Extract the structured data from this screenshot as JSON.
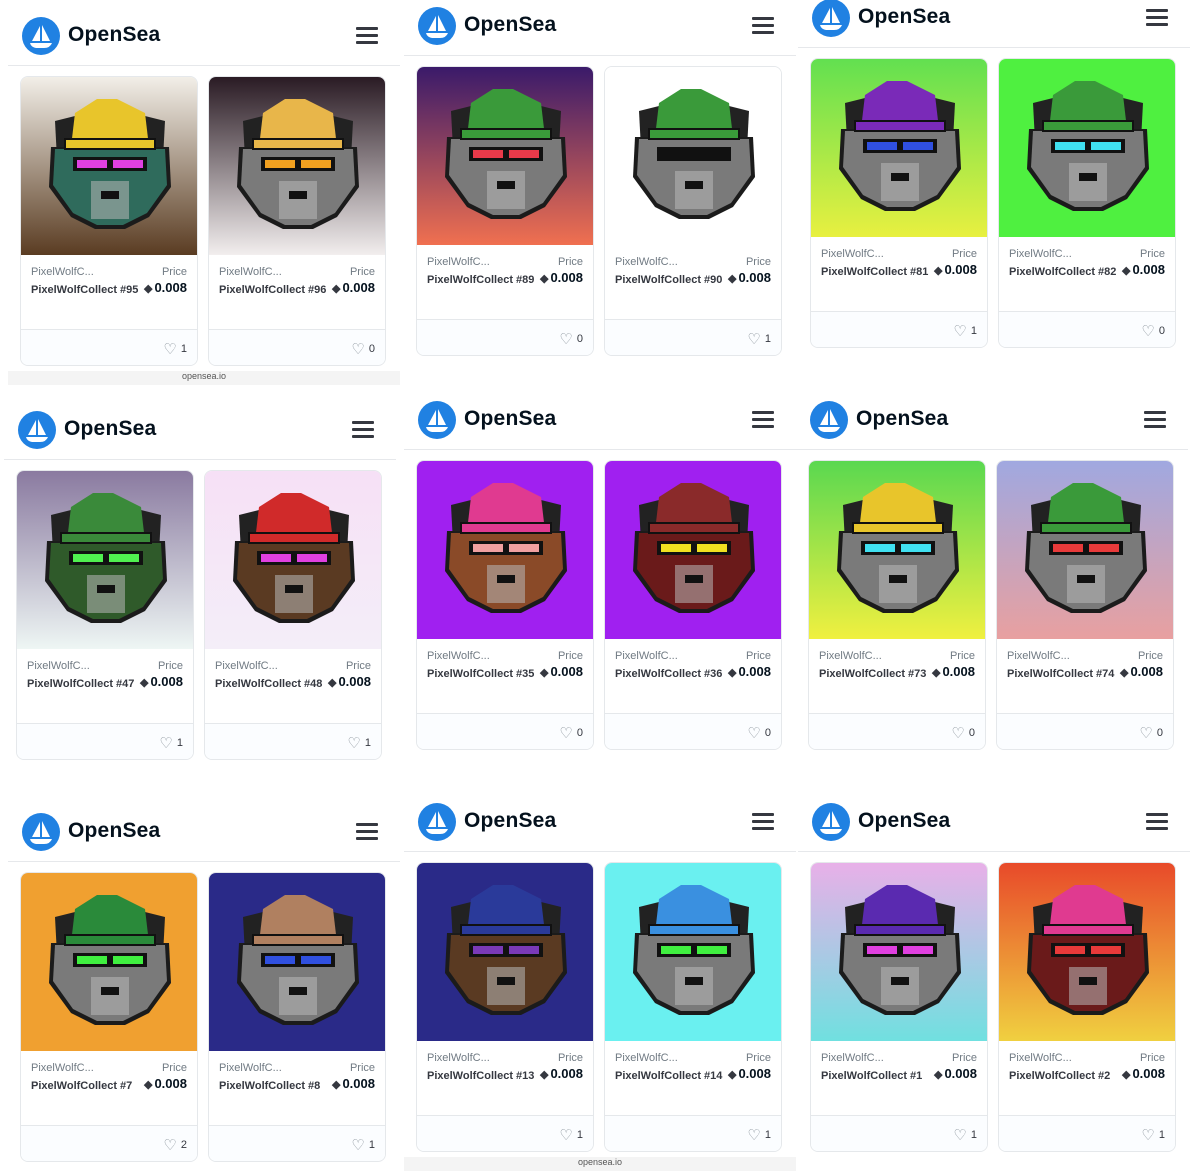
{
  "brand": "OpenSea",
  "url_text": "opensea.io",
  "price_label": "Price",
  "collection_short": "PixelWolfC...",
  "panels": [
    {
      "cards": [
        {
          "name": "PixelWolfCollect #95",
          "price": "0.008",
          "likes": "1",
          "bg": [
            "#f2efe8",
            "#5a3c22"
          ],
          "fur": "#2f6b5c",
          "hat": "#e8c52b",
          "glasses": "#e040e0"
        },
        {
          "name": "PixelWolfCollect #96",
          "price": "0.008",
          "likes": "0",
          "bg": [
            "#2a1b24",
            "#f2eeee"
          ],
          "fur": "#7a7a7a",
          "hat": "#e8b64a",
          "glasses": "#f0a020"
        }
      ]
    },
    {
      "cards": [
        {
          "name": "PixelWolfCollect #89",
          "price": "0.008",
          "likes": "0",
          "bg": [
            "#3a1a6a",
            "#f07050"
          ],
          "fur": "#7a7a7a",
          "hat": "#3a9a3a",
          "glasses": "#e83a4a"
        },
        {
          "name": "PixelWolfCollect #90",
          "price": "0.008",
          "likes": "1",
          "bg": [
            "#ffffff",
            "#ffffff"
          ],
          "fur": "#7a7a7a",
          "hat": "#3a9a3a",
          "glasses": "#111111"
        }
      ]
    },
    {
      "cards": [
        {
          "name": "PixelWolfCollect #81",
          "price": "0.008",
          "likes": "1",
          "bg": [
            "#62e050",
            "#e8f040"
          ],
          "fur": "#7a7a7a",
          "hat": "#7a2ab8",
          "glasses": "#3050e0"
        },
        {
          "name": "PixelWolfCollect #82",
          "price": "0.008",
          "likes": "0",
          "bg": [
            "#4ff040",
            "#4ff040"
          ],
          "fur": "#7a7a7a",
          "hat": "#3a9a3a",
          "glasses": "#40e0f0"
        }
      ]
    },
    {
      "cards": [
        {
          "name": "PixelWolfCollect #47",
          "price": "0.008",
          "likes": "1",
          "bg": [
            "#8a7aa0",
            "#eef6f4"
          ],
          "fur": "#2f5a2a",
          "hat": "#3a8a3a",
          "glasses": "#50f050"
        },
        {
          "name": "PixelWolfCollect #48",
          "price": "0.008",
          "likes": "1",
          "bg": [
            "#f6e0f6",
            "#f4eef8"
          ],
          "fur": "#5a3a22",
          "hat": "#d02a2a",
          "glasses": "#e040e0"
        }
      ]
    },
    {
      "cards": [
        {
          "name": "PixelWolfCollect #35",
          "price": "0.008",
          "likes": "0",
          "bg": [
            "#a020f0",
            "#a020f0"
          ],
          "fur": "#8a4a28",
          "hat": "#e03a90",
          "glasses": "#f0a0a0"
        },
        {
          "name": "PixelWolfCollect #36",
          "price": "0.008",
          "likes": "0",
          "bg": [
            "#a020f0",
            "#a020f0"
          ],
          "fur": "#6a1a1a",
          "hat": "#8a2a2a",
          "glasses": "#f0e020"
        }
      ]
    },
    {
      "cards": [
        {
          "name": "PixelWolfCollect #73",
          "price": "0.008",
          "likes": "0",
          "bg": [
            "#5ad850",
            "#f0f040"
          ],
          "fur": "#7a7a7a",
          "hat": "#e8c52b",
          "glasses": "#40e0f0"
        },
        {
          "name": "PixelWolfCollect #74",
          "price": "0.008",
          "likes": "0",
          "bg": [
            "#a0a8e0",
            "#e8a0a0"
          ],
          "fur": "#7a7a7a",
          "hat": "#3a9a3a",
          "glasses": "#e83a3a"
        }
      ]
    },
    {
      "cards": [
        {
          "name": "PixelWolfCollect #7",
          "price": "0.008",
          "likes": "2",
          "bg": [
            "#f0a030",
            "#f0a030"
          ],
          "fur": "#7a7a7a",
          "hat": "#2a8a3a",
          "glasses": "#40f040"
        },
        {
          "name": "PixelWolfCollect #8",
          "price": "0.008",
          "likes": "1",
          "bg": [
            "#2a2a88",
            "#2a2a88"
          ],
          "fur": "#7a7a7a",
          "hat": "#b08060",
          "glasses": "#3050e0"
        }
      ]
    },
    {
      "cards": [
        {
          "name": "PixelWolfCollect #13",
          "price": "0.008",
          "likes": "1",
          "bg": [
            "#2a2a88",
            "#2a2a88"
          ],
          "fur": "#5a3a22",
          "hat": "#2a3a9a",
          "glasses": "#7a3ab8"
        },
        {
          "name": "PixelWolfCollect #14",
          "price": "0.008",
          "likes": "1",
          "bg": [
            "#6af0f0",
            "#6af0f0"
          ],
          "fur": "#7a7a7a",
          "hat": "#3a90e0",
          "glasses": "#40f040"
        }
      ]
    },
    {
      "cards": [
        {
          "name": "PixelWolfCollect #1",
          "price": "0.008",
          "likes": "1",
          "bg": [
            "#e8b0e8",
            "#70e0e0"
          ],
          "fur": "#7a7a7a",
          "hat": "#5a2ab0",
          "glasses": "#e040e0"
        },
        {
          "name": "PixelWolfCollect #2",
          "price": "0.008",
          "likes": "1",
          "bg": [
            "#e84a2a",
            "#f0d040"
          ],
          "fur": "#6a1a1a",
          "hat": "#e03a90",
          "glasses": "#e83a3a"
        }
      ]
    }
  ]
}
